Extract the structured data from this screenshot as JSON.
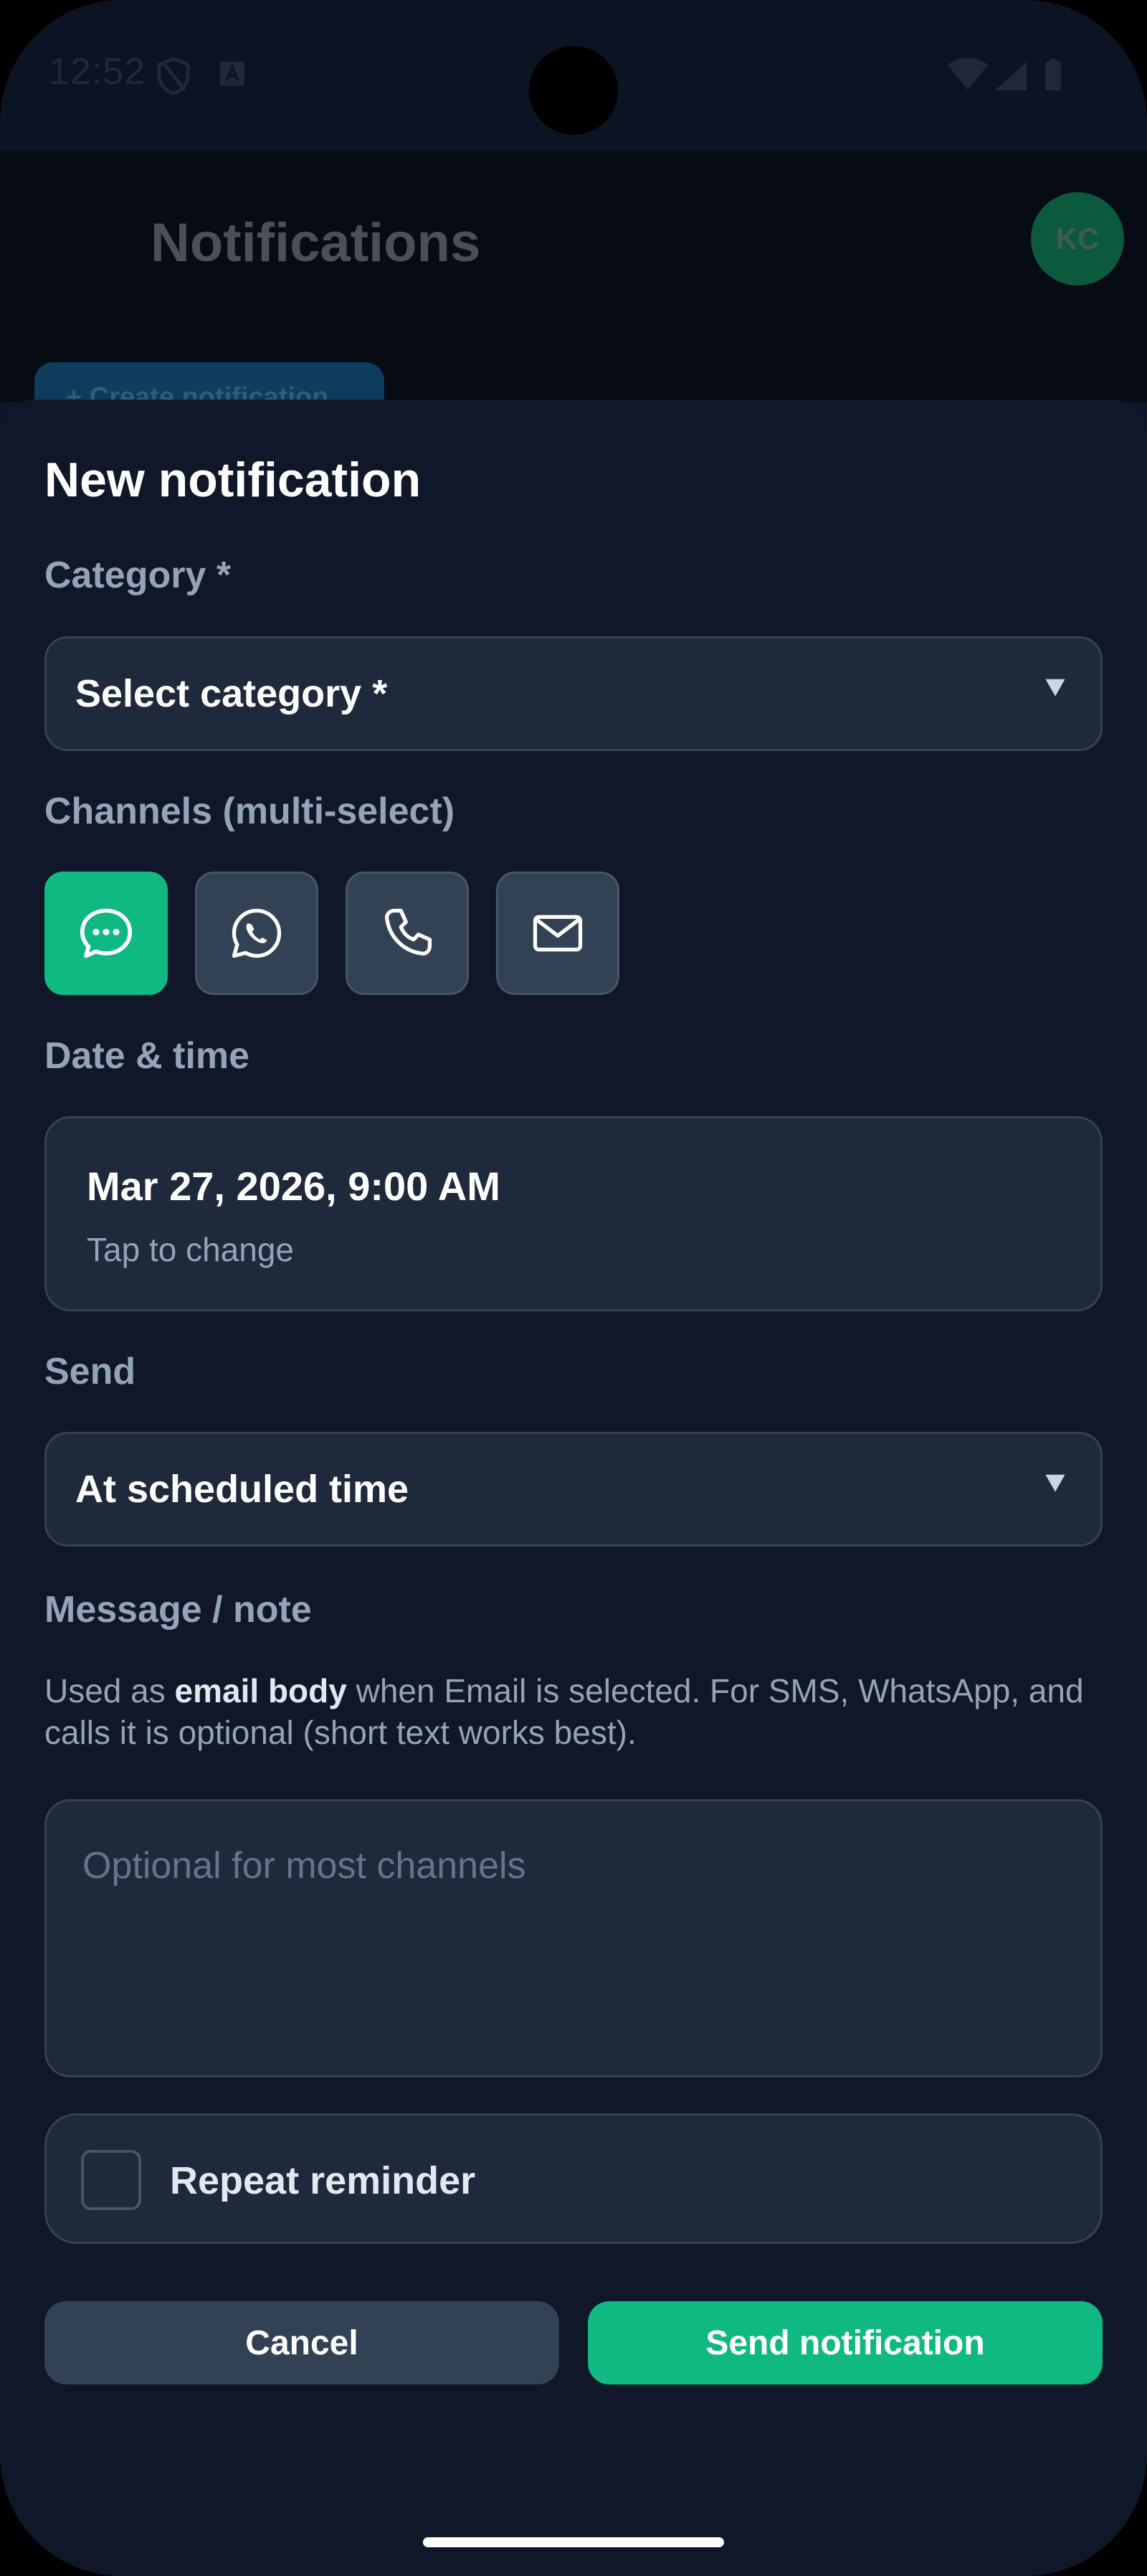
{
  "status_bar": {
    "time": "12:52",
    "icons": [
      "shield-icon",
      "a-badge-icon",
      "wifi-icon",
      "signal-icon",
      "battery-icon"
    ]
  },
  "app_bar": {
    "title": "Notifications",
    "avatar_initials": "KC",
    "create_button_label": "+ Create notification"
  },
  "sheet": {
    "title": "New notification",
    "category": {
      "label": "Category *",
      "selected": "Select category *"
    },
    "channels": {
      "label": "Channels (multi-select)",
      "items": [
        {
          "icon": "sms-icon",
          "selected": true
        },
        {
          "icon": "whatsapp-icon",
          "selected": false
        },
        {
          "icon": "phone-icon",
          "selected": false
        },
        {
          "icon": "email-icon",
          "selected": false
        }
      ]
    },
    "datetime": {
      "label": "Date & time",
      "value": "Mar 27, 2026, 9:00 AM",
      "hint": "Tap to change"
    },
    "send": {
      "label": "Send",
      "selected": "At scheduled time"
    },
    "message": {
      "label": "Message / note",
      "helper_prefix": "Used as ",
      "helper_bold": "email body",
      "helper_suffix": " when Email is selected. For SMS, WhatsApp, and calls it is optional (short text works best).",
      "placeholder": "Optional for most channels"
    },
    "repeat": {
      "label": "Repeat reminder",
      "checked": false
    },
    "actions": {
      "cancel_label": "Cancel",
      "send_label": "Send notification"
    }
  },
  "colors": {
    "accent": "#10b981",
    "sheet_bg": "#0f1729",
    "field_bg": "#1e293b",
    "label": "#94a3b8"
  }
}
